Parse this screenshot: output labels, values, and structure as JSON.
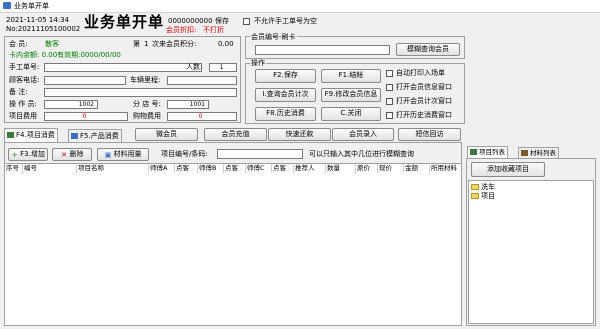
{
  "window": {
    "title": "业务单开单"
  },
  "header": {
    "datetime": "2021-11-05 14:34",
    "order_no": "No:20211105100002",
    "big_title": "业务单开单",
    "code": "0000000000",
    "save_label": "保存",
    "member_discount": "会员折扣:",
    "no_print": "不打折",
    "no_manual_no_label": "不允许手工单号为空"
  },
  "member": {
    "member_label": "会  员:",
    "member_value": "散客",
    "times_label": "第",
    "times_value": "1",
    "times_suffix": "次来会员积分:",
    "points": "0.00",
    "card_balance": "卡内余额: 0.00有效期:0000/00/00",
    "manual_no_label": "手工单号:",
    "people_label": "人数:",
    "people_value": "1",
    "phone_label": "顾客电话:",
    "mileage_label": "车辆里程:",
    "remark_label": "备    注:",
    "operator_label": "操 作 员:",
    "operator_value": "1002",
    "store_label": "分 店 号:",
    "store_value": "1001",
    "item_fee_label": "项目费用",
    "item_fee_value": "0",
    "purchase_fee_label": "购物费用",
    "purchase_fee_value": "0"
  },
  "card_swipe": {
    "label": "会员编号-刷卡",
    "fuzzy_query_btn": "模糊查询会员"
  },
  "ops": {
    "label": "操作",
    "buttons": [
      "F2.保存",
      "F1.结帐",
      "I.查询会员计次",
      "F9.修改会员信息",
      "F8.历史消费",
      "C.关闭"
    ],
    "checkboxes": [
      "自动打印入场单",
      "打开会员信息窗口",
      "打开会员计次窗口",
      "打开历史消费窗口"
    ]
  },
  "tabs": {
    "item_tab": "F4.项目消费",
    "product_tab": "F5.产品消费"
  },
  "mid_buttons": [
    "微会员",
    "会员充值",
    "快速还款",
    "会员录入",
    "短信回访"
  ],
  "toolbar": {
    "add": "F3.增加",
    "delete": "删除",
    "material": "材料用量",
    "item_no_label": "项目编号/条码:",
    "hint": "可以只输入其中几位进行模糊查询"
  },
  "table": {
    "columns": [
      "序号",
      "编号",
      "项目名称",
      "师傅A",
      "点客",
      "师傅B",
      "点客",
      "师傅C",
      "点客",
      "推荐人",
      "数量",
      "原价",
      "现价",
      "金额",
      "所用材料"
    ]
  },
  "right_panel": {
    "tab_items": "项目列表",
    "tab_materials": "材料列表",
    "add_favorite": "添加收藏项目",
    "tree": [
      "洗车",
      "项目"
    ]
  }
}
